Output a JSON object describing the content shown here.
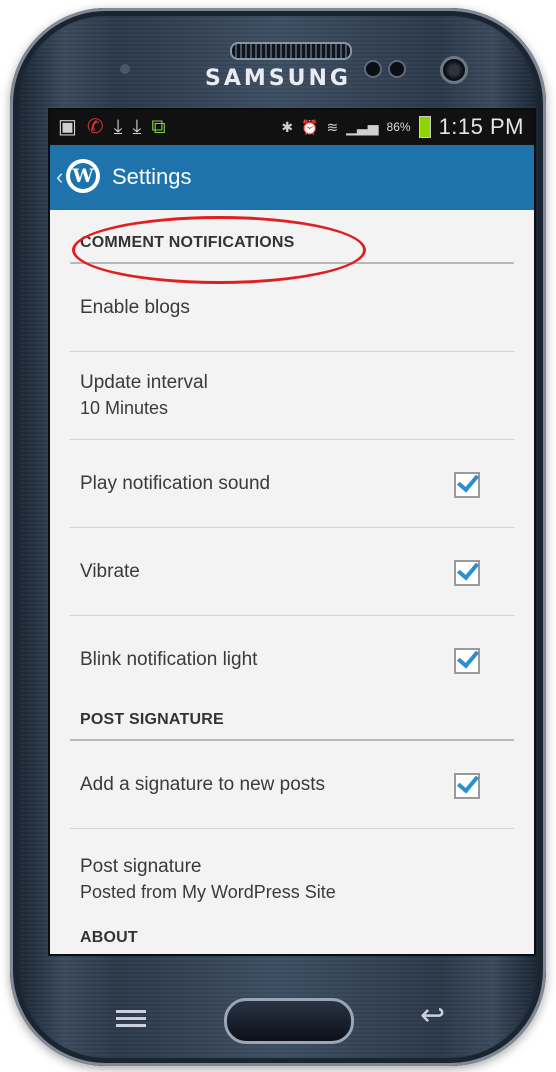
{
  "device": {
    "brand": "SAMSUNG"
  },
  "status_bar": {
    "battery": "86%",
    "time": "1:15 PM"
  },
  "app_bar": {
    "title": "Settings"
  },
  "sections": {
    "comment_notifications": {
      "header": "COMMENT NOTIFICATIONS",
      "items": [
        {
          "label": "Enable blogs"
        },
        {
          "label": "Update interval",
          "summary": "10 Minutes"
        },
        {
          "label": "Play notification sound",
          "checked": true
        },
        {
          "label": "Vibrate",
          "checked": true
        },
        {
          "label": "Blink notification light",
          "checked": true
        }
      ]
    },
    "post_signature": {
      "header": "POST SIGNATURE",
      "items": [
        {
          "label": "Add a signature to new posts",
          "checked": true
        },
        {
          "label": "Post signature",
          "summary": "Posted from My WordPress Site"
        }
      ]
    },
    "about": {
      "header": "ABOUT"
    }
  },
  "annotation": {
    "highlight_color": "#e02020"
  },
  "colors": {
    "app_bar": "#1e73ad",
    "checkmark": "#2a8ed0"
  }
}
